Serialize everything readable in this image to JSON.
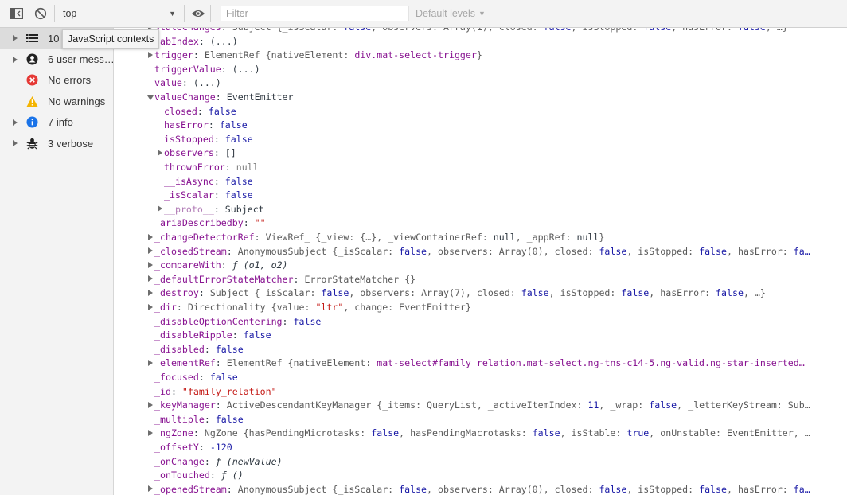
{
  "toolbar": {
    "context": "top",
    "filter_placeholder": "Filter",
    "levels_label": "Default levels"
  },
  "sidebar": {
    "tooltip": "JavaScript contexts",
    "items": [
      {
        "label": "10",
        "icon": "list-icon"
      },
      {
        "label": "6 user mess…",
        "icon": "user-icon"
      },
      {
        "label": "No errors",
        "icon": "error-icon"
      },
      {
        "label": "No warnings",
        "icon": "warning-icon"
      },
      {
        "label": "7 info",
        "icon": "info-icon"
      },
      {
        "label": "3 verbose",
        "icon": "bug-icon"
      }
    ]
  },
  "console_lines": [
    {
      "indent": 1,
      "tri": "r",
      "parts": [
        {
          "c": "k",
          "t": "stateChanges"
        },
        {
          "c": "",
          "t": ": "
        },
        {
          "c": "obj",
          "t": "Subject {_isScalar: "
        },
        {
          "c": "b",
          "t": "false"
        },
        {
          "c": "obj",
          "t": ", observers: Array(1), closed: "
        },
        {
          "c": "b",
          "t": "false"
        },
        {
          "c": "obj",
          "t": ", isStopped: "
        },
        {
          "c": "b",
          "t": "false"
        },
        {
          "c": "obj",
          "t": ", hasError: "
        },
        {
          "c": "b",
          "t": "false"
        },
        {
          "c": "obj",
          "t": ", …}"
        }
      ]
    },
    {
      "indent": 1,
      "tri": "",
      "parts": [
        {
          "c": "k",
          "t": "tabIndex"
        },
        {
          "c": "",
          "t": ": (...)"
        }
      ]
    },
    {
      "indent": 1,
      "tri": "r",
      "parts": [
        {
          "c": "k",
          "t": "trigger"
        },
        {
          "c": "",
          "t": ": "
        },
        {
          "c": "obj",
          "t": "ElementRef {nativeElement: "
        },
        {
          "c": "k",
          "t": "div.mat-select-trigger"
        },
        {
          "c": "obj",
          "t": "}"
        }
      ]
    },
    {
      "indent": 1,
      "tri": "",
      "parts": [
        {
          "c": "k",
          "t": "triggerValue"
        },
        {
          "c": "",
          "t": ": (...)"
        }
      ]
    },
    {
      "indent": 1,
      "tri": "",
      "parts": [
        {
          "c": "k",
          "t": "value"
        },
        {
          "c": "",
          "t": ": (...)"
        }
      ]
    },
    {
      "indent": 1,
      "tri": "d",
      "parts": [
        {
          "c": "k",
          "t": "valueChange"
        },
        {
          "c": "",
          "t": ": EventEmitter"
        }
      ]
    },
    {
      "indent": 2,
      "tri": "",
      "parts": [
        {
          "c": "k",
          "t": "closed"
        },
        {
          "c": "",
          "t": ": "
        },
        {
          "c": "b",
          "t": "false"
        }
      ]
    },
    {
      "indent": 2,
      "tri": "",
      "parts": [
        {
          "c": "k",
          "t": "hasError"
        },
        {
          "c": "",
          "t": ": "
        },
        {
          "c": "b",
          "t": "false"
        }
      ]
    },
    {
      "indent": 2,
      "tri": "",
      "parts": [
        {
          "c": "k",
          "t": "isStopped"
        },
        {
          "c": "",
          "t": ": "
        },
        {
          "c": "b",
          "t": "false"
        }
      ]
    },
    {
      "indent": 2,
      "tri": "r",
      "parts": [
        {
          "c": "k",
          "t": "observers"
        },
        {
          "c": "",
          "t": ": []"
        }
      ]
    },
    {
      "indent": 2,
      "tri": "",
      "parts": [
        {
          "c": "k",
          "t": "thrownError"
        },
        {
          "c": "",
          "t": ": "
        },
        {
          "c": "g",
          "t": "null"
        }
      ]
    },
    {
      "indent": 2,
      "tri": "",
      "parts": [
        {
          "c": "k",
          "t": "__isAsync"
        },
        {
          "c": "",
          "t": ": "
        },
        {
          "c": "b",
          "t": "false"
        }
      ]
    },
    {
      "indent": 2,
      "tri": "",
      "parts": [
        {
          "c": "k",
          "t": "_isScalar"
        },
        {
          "c": "",
          "t": ": "
        },
        {
          "c": "b",
          "t": "false"
        }
      ]
    },
    {
      "indent": 2,
      "tri": "r",
      "parts": [
        {
          "c": "kd",
          "t": "__proto__"
        },
        {
          "c": "",
          "t": ": Subject"
        }
      ]
    },
    {
      "indent": 1,
      "tri": "",
      "parts": [
        {
          "c": "k",
          "t": "_ariaDescribedby"
        },
        {
          "c": "",
          "t": ": "
        },
        {
          "c": "s",
          "t": "\"\""
        }
      ]
    },
    {
      "indent": 1,
      "tri": "r",
      "parts": [
        {
          "c": "k",
          "t": "_changeDetectorRef"
        },
        {
          "c": "",
          "t": ": "
        },
        {
          "c": "obj",
          "t": "ViewRef_ {_view: {…}, _viewContainerRef: "
        },
        {
          "c": "",
          "t": "null"
        },
        {
          "c": "obj",
          "t": ", _appRef: "
        },
        {
          "c": "",
          "t": "null"
        },
        {
          "c": "obj",
          "t": "}"
        }
      ]
    },
    {
      "indent": 1,
      "tri": "r",
      "parts": [
        {
          "c": "k",
          "t": "_closedStream"
        },
        {
          "c": "",
          "t": ": "
        },
        {
          "c": "obj",
          "t": "AnonymousSubject {_isScalar: "
        },
        {
          "c": "b",
          "t": "false"
        },
        {
          "c": "obj",
          "t": ", observers: Array(0), closed: "
        },
        {
          "c": "b",
          "t": "false"
        },
        {
          "c": "obj",
          "t": ", isStopped: "
        },
        {
          "c": "b",
          "t": "false"
        },
        {
          "c": "obj",
          "t": ", hasError: "
        },
        {
          "c": "b",
          "t": "fa…"
        }
      ]
    },
    {
      "indent": 1,
      "tri": "r",
      "parts": [
        {
          "c": "k",
          "t": "_compareWith"
        },
        {
          "c": "",
          "t": ": "
        },
        {
          "c": "it",
          "t": "ƒ (o1, o2)"
        }
      ]
    },
    {
      "indent": 1,
      "tri": "r",
      "parts": [
        {
          "c": "k",
          "t": "_defaultErrorStateMatcher"
        },
        {
          "c": "",
          "t": ": "
        },
        {
          "c": "obj",
          "t": "ErrorStateMatcher {}"
        }
      ]
    },
    {
      "indent": 1,
      "tri": "r",
      "parts": [
        {
          "c": "k",
          "t": "_destroy"
        },
        {
          "c": "",
          "t": ": "
        },
        {
          "c": "obj",
          "t": "Subject {_isScalar: "
        },
        {
          "c": "b",
          "t": "false"
        },
        {
          "c": "obj",
          "t": ", observers: Array(7), closed: "
        },
        {
          "c": "b",
          "t": "false"
        },
        {
          "c": "obj",
          "t": ", isStopped: "
        },
        {
          "c": "b",
          "t": "false"
        },
        {
          "c": "obj",
          "t": ", hasError: "
        },
        {
          "c": "b",
          "t": "false"
        },
        {
          "c": "obj",
          "t": ", …}"
        }
      ]
    },
    {
      "indent": 1,
      "tri": "r",
      "parts": [
        {
          "c": "k",
          "t": "_dir"
        },
        {
          "c": "",
          "t": ": "
        },
        {
          "c": "obj",
          "t": "Directionality {value: "
        },
        {
          "c": "s",
          "t": "\"ltr\""
        },
        {
          "c": "obj",
          "t": ", change: EventEmitter}"
        }
      ]
    },
    {
      "indent": 1,
      "tri": "",
      "parts": [
        {
          "c": "k",
          "t": "_disableOptionCentering"
        },
        {
          "c": "",
          "t": ": "
        },
        {
          "c": "b",
          "t": "false"
        }
      ]
    },
    {
      "indent": 1,
      "tri": "",
      "parts": [
        {
          "c": "k",
          "t": "_disableRipple"
        },
        {
          "c": "",
          "t": ": "
        },
        {
          "c": "b",
          "t": "false"
        }
      ]
    },
    {
      "indent": 1,
      "tri": "",
      "parts": [
        {
          "c": "k",
          "t": "_disabled"
        },
        {
          "c": "",
          "t": ": "
        },
        {
          "c": "b",
          "t": "false"
        }
      ]
    },
    {
      "indent": 1,
      "tri": "r",
      "parts": [
        {
          "c": "k",
          "t": "_elementRef"
        },
        {
          "c": "",
          "t": ": "
        },
        {
          "c": "obj",
          "t": "ElementRef {nativeElement: "
        },
        {
          "c": "k",
          "t": "mat-select#family_relation.mat-select.ng-tns-c14-5.ng-valid.ng-star-inserted…"
        }
      ]
    },
    {
      "indent": 1,
      "tri": "",
      "parts": [
        {
          "c": "k",
          "t": "_focused"
        },
        {
          "c": "",
          "t": ": "
        },
        {
          "c": "b",
          "t": "false"
        }
      ]
    },
    {
      "indent": 1,
      "tri": "",
      "parts": [
        {
          "c": "k",
          "t": "_id"
        },
        {
          "c": "",
          "t": ": "
        },
        {
          "c": "s",
          "t": "\"family_relation\""
        }
      ]
    },
    {
      "indent": 1,
      "tri": "r",
      "parts": [
        {
          "c": "k",
          "t": "_keyManager"
        },
        {
          "c": "",
          "t": ": "
        },
        {
          "c": "obj",
          "t": "ActiveDescendantKeyManager {_items: QueryList, _activeItemIndex: "
        },
        {
          "c": "n",
          "t": "11"
        },
        {
          "c": "obj",
          "t": ", _wrap: "
        },
        {
          "c": "b",
          "t": "false"
        },
        {
          "c": "obj",
          "t": ", _letterKeyStream: Sub…"
        }
      ]
    },
    {
      "indent": 1,
      "tri": "",
      "parts": [
        {
          "c": "k",
          "t": "_multiple"
        },
        {
          "c": "",
          "t": ": "
        },
        {
          "c": "b",
          "t": "false"
        }
      ]
    },
    {
      "indent": 1,
      "tri": "r",
      "parts": [
        {
          "c": "k",
          "t": "_ngZone"
        },
        {
          "c": "",
          "t": ": "
        },
        {
          "c": "obj",
          "t": "NgZone {hasPendingMicrotasks: "
        },
        {
          "c": "b",
          "t": "false"
        },
        {
          "c": "obj",
          "t": ", hasPendingMacrotasks: "
        },
        {
          "c": "b",
          "t": "false"
        },
        {
          "c": "obj",
          "t": ", isStable: "
        },
        {
          "c": "b",
          "t": "true"
        },
        {
          "c": "obj",
          "t": ", onUnstable: EventEmitter, …"
        }
      ]
    },
    {
      "indent": 1,
      "tri": "",
      "parts": [
        {
          "c": "k",
          "t": "_offsetY"
        },
        {
          "c": "",
          "t": ": "
        },
        {
          "c": "n",
          "t": "-120"
        }
      ]
    },
    {
      "indent": 1,
      "tri": "",
      "parts": [
        {
          "c": "k",
          "t": "_onChange"
        },
        {
          "c": "",
          "t": ": "
        },
        {
          "c": "it",
          "t": "ƒ (newValue)"
        }
      ]
    },
    {
      "indent": 1,
      "tri": "",
      "parts": [
        {
          "c": "k",
          "t": "_onTouched"
        },
        {
          "c": "",
          "t": ": "
        },
        {
          "c": "it",
          "t": "ƒ ()"
        }
      ]
    },
    {
      "indent": 1,
      "tri": "r",
      "parts": [
        {
          "c": "k",
          "t": "_openedStream"
        },
        {
          "c": "",
          "t": ": "
        },
        {
          "c": "obj",
          "t": "AnonymousSubject {_isScalar: "
        },
        {
          "c": "b",
          "t": "false"
        },
        {
          "c": "obj",
          "t": ", observers: Array(0), closed: "
        },
        {
          "c": "b",
          "t": "false"
        },
        {
          "c": "obj",
          "t": ", isStopped: "
        },
        {
          "c": "b",
          "t": "false"
        },
        {
          "c": "obj",
          "t": ", hasError: "
        },
        {
          "c": "b",
          "t": "fa…"
        }
      ]
    }
  ]
}
